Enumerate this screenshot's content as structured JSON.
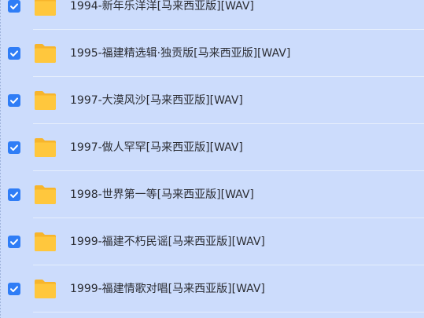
{
  "files": [
    {
      "name": "1994-新年乐洋洋[马来西亚版][WAV]",
      "checked": true
    },
    {
      "name": "1995-福建精选辑·独贡版[马来西亚版][WAV]",
      "checked": true
    },
    {
      "name": "1997-大漠风沙[马来西亚版][WAV]",
      "checked": true
    },
    {
      "name": "1997-做人罕罕[马来西亚版][WAV]",
      "checked": true
    },
    {
      "name": "1998-世界第一等[马来西亚版][WAV]",
      "checked": true
    },
    {
      "name": "1999-福建不朽民谣[马来西亚版][WAV]",
      "checked": true
    },
    {
      "name": "1999-福建情歌对唱[马来西亚版][WAV]",
      "checked": true
    }
  ],
  "colors": {
    "background": "#ccdcfc",
    "checkbox": "#2f7df6",
    "folder": "#ffc73d",
    "folder_back": "#f7b52c",
    "text": "#2b2d33"
  },
  "icons": {
    "checkbox": "checkbox-checked-icon",
    "folder": "folder-icon"
  }
}
